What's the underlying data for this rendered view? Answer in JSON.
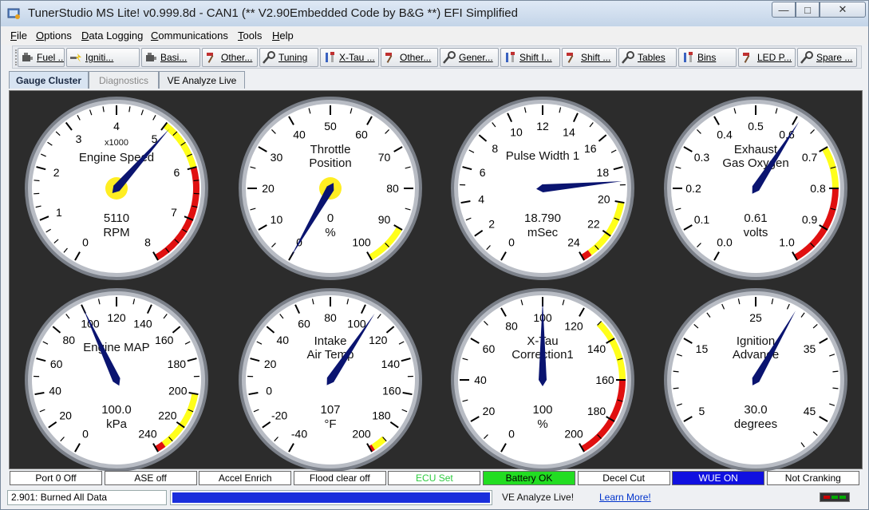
{
  "window": {
    "title": "TunerStudio MS Lite! v0.999.8d - CAN1 (** V2.90Embedded Code by B&G **) EFI Simplified",
    "controls": {
      "minimize": "—",
      "maximize": "□",
      "close": "✕"
    }
  },
  "menu": [
    "File",
    "Options",
    "Data Logging",
    "Communications",
    "Tools",
    "Help"
  ],
  "toolbar": [
    {
      "label": "Fuel ...",
      "icon": "engine-icon"
    },
    {
      "label": "Igniti...",
      "icon": "spark-icon"
    },
    {
      "label": "Basi...",
      "icon": "engine-icon"
    },
    {
      "label": "Other...",
      "icon": "hammer-icon"
    },
    {
      "label": "Tuning",
      "icon": "wrench-icon"
    },
    {
      "label": "X-Tau ...",
      "icon": "screwdriver-icon"
    },
    {
      "label": "Other...",
      "icon": "hammer-icon"
    },
    {
      "label": "Gener...",
      "icon": "wrench-icon"
    },
    {
      "label": "Shift I...",
      "icon": "screwdriver-icon"
    },
    {
      "label": "Shift ...",
      "icon": "hammer-icon"
    },
    {
      "label": "Tables",
      "icon": "wrench-icon"
    },
    {
      "label": "Bins",
      "icon": "screwdriver-icon"
    },
    {
      "label": "LED P...",
      "icon": "hammer-icon"
    },
    {
      "label": "Spare ...",
      "icon": "wrench-icon"
    }
  ],
  "tabs": [
    {
      "label": "Gauge Cluster",
      "state": "active"
    },
    {
      "label": "Diagnostics",
      "state": "disabled"
    },
    {
      "label": "VE Analyze Live",
      "state": "normal"
    }
  ],
  "gauges": [
    {
      "title": [
        "x1000",
        "Engine Speed"
      ],
      "value": "5110",
      "units": "RPM",
      "min": 0,
      "max": 8,
      "labels": [
        0,
        1,
        2,
        3,
        4,
        5,
        6,
        7,
        8
      ],
      "minor": 4,
      "current": 5.11,
      "warn": 5,
      "danger": 6,
      "hub_yellow": true
    },
    {
      "title": [
        "Throttle",
        "Position"
      ],
      "value": "0",
      "units": "%",
      "min": 0,
      "max": 100,
      "labels": [
        0,
        10,
        20,
        30,
        40,
        50,
        60,
        70,
        80,
        90,
        100
      ],
      "minor": 2,
      "current": 0,
      "warn": 90,
      "danger": null,
      "hub_yellow": true
    },
    {
      "title": [
        "Pulse Width 1"
      ],
      "value": "18.790",
      "units": "mSec",
      "min": 0,
      "max": 24,
      "labels": [
        0,
        2,
        4,
        6,
        8,
        10,
        12,
        14,
        16,
        18,
        20,
        22,
        24
      ],
      "minor": 2,
      "current": 18.79,
      "warn": 20,
      "danger": 23.5,
      "hub_yellow": false
    },
    {
      "title": [
        "Exhaust",
        "Gas Oxygen"
      ],
      "value": "0.61",
      "units": "volts",
      "min": 0,
      "max": 1,
      "labels": [
        "0.0",
        "0.1",
        "0.2",
        "0.3",
        "0.4",
        "0.5",
        "0.6",
        "0.7",
        "0.8",
        "0.9",
        "1.0"
      ],
      "minor": 2,
      "current": 0.61,
      "warn": 0.7,
      "danger": 0.8,
      "hub_yellow": false
    },
    {
      "title": [
        "Engine MAP"
      ],
      "value": "100.0",
      "units": "kPa",
      "min": 0,
      "max": 240,
      "labels": [
        0,
        20,
        40,
        60,
        80,
        100,
        120,
        140,
        160,
        180,
        200,
        220,
        240
      ],
      "minor": 2,
      "current": 100,
      "warn": 200,
      "danger": 235,
      "hub_yellow": false
    },
    {
      "title": [
        "Intake",
        "Air Temp"
      ],
      "value": "107",
      "units": "°F",
      "min": -40,
      "max": 200,
      "labels": [
        -40,
        -20,
        0,
        20,
        40,
        60,
        80,
        100,
        120,
        140,
        160,
        180,
        200
      ],
      "minor": 2,
      "current": 107,
      "warn": 190,
      "danger": 198,
      "hub_yellow": false
    },
    {
      "title": [
        "X-Tau",
        "Correction1"
      ],
      "value": "100",
      "units": "%",
      "min": 0,
      "max": 200,
      "labels": [
        0,
        20,
        40,
        60,
        80,
        100,
        120,
        140,
        160,
        180,
        200
      ],
      "minor": 2,
      "current": 100,
      "warn": 130,
      "danger": 160,
      "hub_yellow": false
    },
    {
      "title": [
        "Ignition",
        "Advance"
      ],
      "value": "30.0",
      "units": "degrees",
      "min": 0,
      "max": 50,
      "labels": [
        5,
        15,
        25,
        35,
        45
      ],
      "minor": 5,
      "current": 30,
      "warn": null,
      "danger": null,
      "hub_yellow": false
    }
  ],
  "indicators": [
    {
      "label": "Port 0 Off",
      "bg": "#ffffff",
      "fg": "#000000"
    },
    {
      "label": "ASE off",
      "bg": "#ffffff",
      "fg": "#000000"
    },
    {
      "label": "Accel Enrich",
      "bg": "#ffffff",
      "fg": "#000000"
    },
    {
      "label": "Flood clear off",
      "bg": "#ffffff",
      "fg": "#000000"
    },
    {
      "label": "ECU Set",
      "bg": "#ffffff",
      "fg": "#2ecc40"
    },
    {
      "label": "Battery OK",
      "bg": "#22dd22",
      "fg": "#000000"
    },
    {
      "label": "Decel Cut",
      "bg": "#ffffff",
      "fg": "#000000"
    },
    {
      "label": "WUE ON",
      "bg": "#1010e0",
      "fg": "#ffffff"
    },
    {
      "label": "Not Cranking",
      "bg": "#ffffff",
      "fg": "#000000"
    }
  ],
  "status": {
    "message": "2.901: Burned All Data",
    "progress": 1.0,
    "ve_live": "VE Analyze Live!",
    "learn_more": "Learn More!"
  },
  "colors": {
    "needle": "#0a1470",
    "warn": "#ffff1a",
    "danger": "#e01010",
    "panel": "#2c2c2c"
  }
}
